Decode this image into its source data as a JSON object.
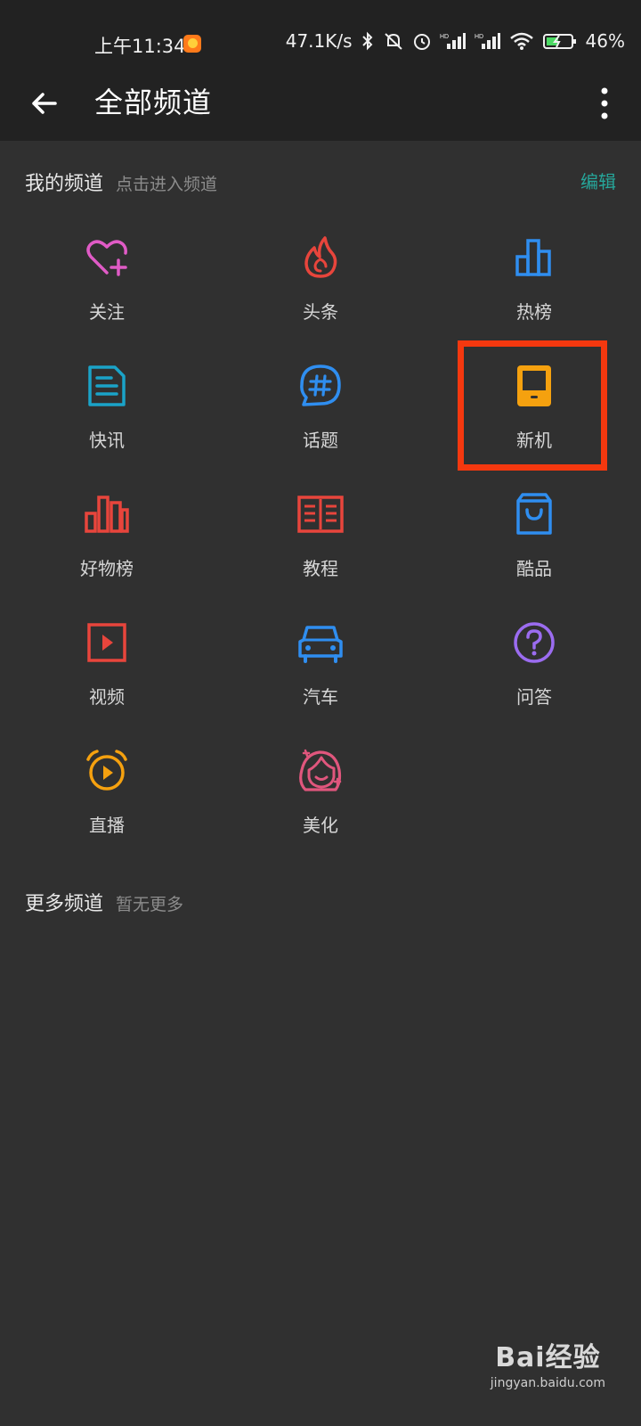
{
  "status_bar": {
    "time": "上午11:34",
    "net_speed": "47.1K/s",
    "battery": "46%"
  },
  "app_bar": {
    "title": "全部频道"
  },
  "my_channels": {
    "title": "我的频道",
    "hint": "点击进入频道",
    "edit_label": "编辑"
  },
  "channels": [
    {
      "label": "关注",
      "icon": "heart-plus-icon",
      "color": "#e05bc6"
    },
    {
      "label": "头条",
      "icon": "flame-icon",
      "color": "#e8453c"
    },
    {
      "label": "热榜",
      "icon": "bar-chart-icon",
      "color": "#2f8ef0"
    },
    {
      "label": "快讯",
      "icon": "document-icon",
      "color": "#1aa3c8"
    },
    {
      "label": "话题",
      "icon": "hashtag-bubble-icon",
      "color": "#2f8ef0"
    },
    {
      "label": "新机",
      "icon": "phone-icon",
      "color": "#f5a10f"
    },
    {
      "label": "好物榜",
      "icon": "ranking-bars-icon",
      "color": "#e8453c"
    },
    {
      "label": "教程",
      "icon": "book-icon",
      "color": "#e8453c"
    },
    {
      "label": "酷品",
      "icon": "shopping-bag-icon",
      "color": "#2f8ef0"
    },
    {
      "label": "视频",
      "icon": "play-square-icon",
      "color": "#e8453c"
    },
    {
      "label": "汽车",
      "icon": "car-icon",
      "color": "#2f8ef0"
    },
    {
      "label": "问答",
      "icon": "question-circle-icon",
      "color": "#9b6cf0"
    },
    {
      "label": "直播",
      "icon": "live-alarm-icon",
      "color": "#f5a10f"
    },
    {
      "label": "美化",
      "icon": "girl-face-icon",
      "color": "#e0567d"
    }
  ],
  "more_channels": {
    "title": "更多频道",
    "hint": "暂无更多"
  },
  "watermark": {
    "logo": "Bai经验",
    "url": "jingyan.baidu.com"
  }
}
